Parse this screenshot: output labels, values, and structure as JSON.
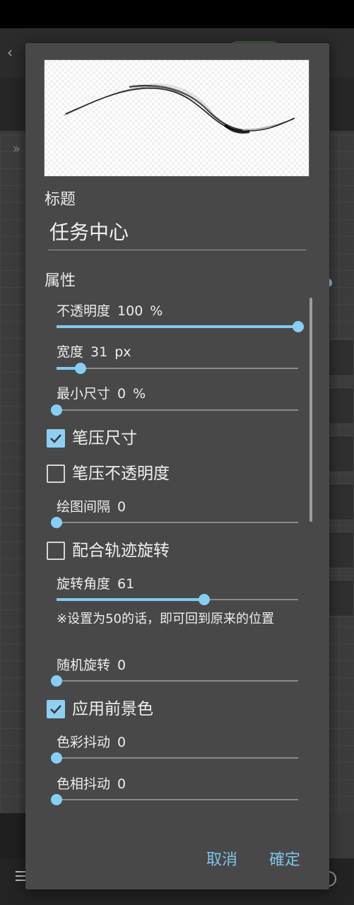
{
  "dialog": {
    "title_section_label": "标题",
    "title_value": "任务中心",
    "properties_section_label": "属性",
    "sliders": {
      "opacity": {
        "label": "不透明度",
        "value": "100",
        "unit": "%",
        "fraction": 1.0
      },
      "width": {
        "label": "宽度",
        "value": "31",
        "unit": "px",
        "fraction": 0.1
      },
      "min_size": {
        "label": "最小尺寸",
        "value": "0",
        "unit": "%",
        "fraction": 0.0
      },
      "spacing": {
        "label": "绘图间隔",
        "value": "0",
        "unit": "",
        "fraction": 0.0
      },
      "rotation_angle": {
        "label": "旋转角度",
        "value": "61",
        "unit": "",
        "fraction": 0.61
      },
      "random_rotation": {
        "label": "随机旋转",
        "value": "0",
        "unit": "",
        "fraction": 0.0
      },
      "color_jitter": {
        "label": "色彩抖动",
        "value": "0",
        "unit": "",
        "fraction": 0.0
      },
      "hue_jitter": {
        "label": "色相抖动",
        "value": "0",
        "unit": "",
        "fraction": 0.0
      }
    },
    "checkboxes": {
      "pressure_size": {
        "label": "笔压尺寸",
        "checked": true
      },
      "pressure_opacity": {
        "label": "笔压不透明度",
        "checked": false
      },
      "follow_path_rotation": {
        "label": "配合轨迹旋转",
        "checked": false
      },
      "use_foreground_color": {
        "label": "应用前景色",
        "checked": true
      }
    },
    "rotation_note": "※设置为50的话，即可回到原来的位置",
    "cancel_label": "取消",
    "ok_label": "確定"
  },
  "colors": {
    "accent": "#82caef",
    "dialog_bg": "#484848"
  }
}
